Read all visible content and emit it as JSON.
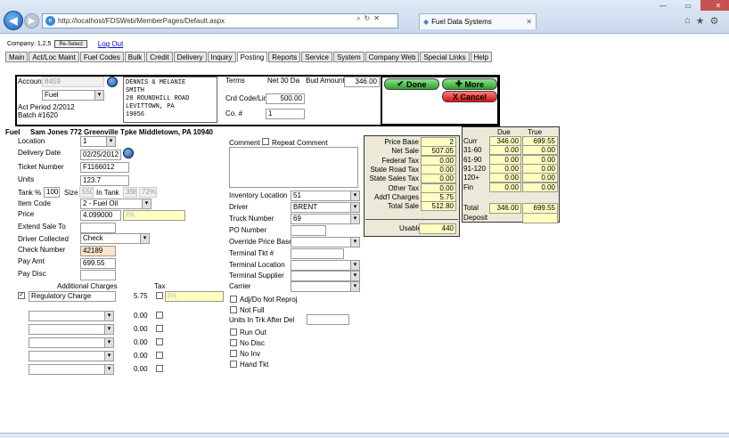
{
  "browser": {
    "url": "http://localhost/FDSWeb/MemberPages/Default.aspx",
    "tab_title": "Fuel Data Systems"
  },
  "company": {
    "label": "Company: 1,2,5",
    "reselect": "Re-Select",
    "logout": "Log Out"
  },
  "nav": [
    "Main",
    "Act/Loc Maint",
    "Fuel Codes",
    "Bulk",
    "Credit",
    "Delivery",
    "Inquiry",
    "Posting",
    "Reports",
    "Service",
    "System",
    "Company Web",
    "Special Links",
    "Help"
  ],
  "header": {
    "account_label": "Account",
    "account_value": "8459",
    "type": "Fuel",
    "act_period": "Act Period 2/2012",
    "batch": "Batch #1620",
    "address": [
      "DENNIS & MELANIE",
      "SMITH",
      "28 ROUNDHILL ROAD",
      "LEVITTOWN, PA",
      "19056"
    ],
    "terms_label": "Terms",
    "terms_value": "Net 30 Da",
    "bud_label": "Bud Amount",
    "bud_value": "346.00",
    "crd_label": "Crd Code/Limit",
    "crd_value": "500.00",
    "co_label": "Co. #",
    "co_value": "1",
    "done": "Done",
    "more": "More",
    "cancel": "X Cancel"
  },
  "fuel_line": {
    "label": "Fuel",
    "name": "Sam Jones 772 Greenville Tpke Middletown, PA 10940"
  },
  "form": {
    "location_label": "Location",
    "location_value": "1",
    "delivery_label": "Delivery Date",
    "delivery_value": "02/25/2012",
    "ticket_label": "Ticket Number",
    "ticket_value": "F1166012",
    "units_label": "Units",
    "units_value": "123.7",
    "tank_label": "Tank %",
    "tank_value": "100",
    "size_label": "Size",
    "size_value": "550",
    "intank_label": "In Tank",
    "intank_value": "398",
    "pct_value": "72%",
    "item_label": "Item Code",
    "item_value": "2 - Fuel Oil",
    "price_label": "Price",
    "price_value": "4.099000",
    "price_code": "PA",
    "extend_label": "Extend Sale To",
    "collected_label": "Driver Collected",
    "collected_value": "Check",
    "check_label": "Check Number",
    "check_value": "42189",
    "payamt_label": "Pay Amt",
    "payamt_value": "699.55",
    "paydisc_label": "Pay Disc"
  },
  "charges": {
    "header": "Additional Charges",
    "tax_header": "Tax",
    "reg_label": "Regulatory Charge",
    "reg_amt": "5.75",
    "reg_tax": "PA",
    "zero": "0.00"
  },
  "middle": {
    "comment_label": "Comment",
    "repeat_label": "Repeat Comment",
    "inv_label": "Inventory Location",
    "inv_value": "51",
    "driver_label": "Driver",
    "driver_value": "BRENT",
    "truck_label": "Truck Number",
    "truck_value": "69",
    "po_label": "PO Number",
    "override_label": "Override Price Base",
    "termtkt_label": "Terminal Tkt #",
    "termloc_label": "Terminal Location",
    "termsup_label": "Terminal Supplier",
    "carrier_label": "Carrier",
    "adj_label": "Adj/Do Not Reproj",
    "notfull_label": "Not Full",
    "units_after_label": "Units In Trk After Del",
    "runout_label": "Run Out",
    "nodisc_label": "No Disc",
    "noinv_label": "No Inv",
    "handtkt_label": "Hand Tkt"
  },
  "summary": {
    "rows": [
      [
        "Price Base",
        "2"
      ],
      [
        "Net Sale",
        "507.05"
      ],
      [
        "Federal Tax",
        "0.00"
      ],
      [
        "State Road Tax",
        "0.00"
      ],
      [
        "State Sales Tax",
        "0.00"
      ],
      [
        "Other Tax",
        "0.00"
      ],
      [
        "Add'l Charges",
        "5.75"
      ],
      [
        "Total Sale",
        "512.80"
      ]
    ],
    "usable_label": "Usable",
    "usable_value": "440"
  },
  "aging": {
    "due_header": "Due",
    "true_header": "True",
    "rows": [
      [
        "Curr",
        "346.00",
        "699.55"
      ],
      [
        "31-60",
        "0.00",
        "0.00"
      ],
      [
        "61-90",
        "0.00",
        "0.00"
      ],
      [
        "91-120",
        "0.00",
        "0.00"
      ],
      [
        "120+",
        "0.00",
        "0.00"
      ],
      [
        "Fin",
        "0.00",
        "0.00"
      ]
    ],
    "total_label": "Total",
    "total_due": "346.00",
    "total_true": "699.55",
    "deposit_label": "Deposit"
  }
}
